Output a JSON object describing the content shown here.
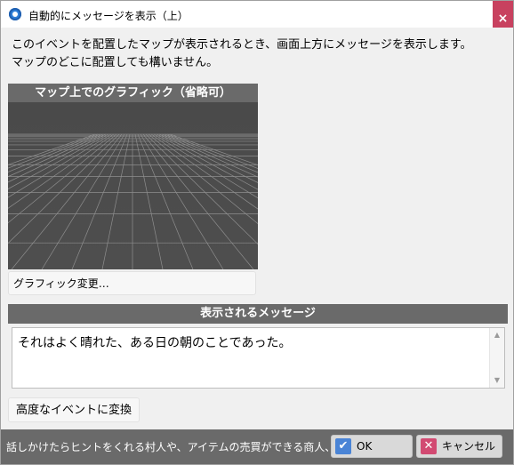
{
  "window": {
    "title": "自動的にメッセージを表示（上）",
    "close_glyph": "×",
    "icon": "app-gear-icon",
    "accent_close": "#c8415f"
  },
  "description": {
    "line1": "このイベントを配置したマップが表示されるとき、画面上方にメッセージを表示します。",
    "line2": "マップのどこに配置しても構いません。"
  },
  "graphic": {
    "header": "マップ上でのグラフィック（省略可）",
    "change_button": "グラフィック変更…"
  },
  "message": {
    "header": "表示されるメッセージ",
    "text": "それはよく晴れた、ある日の朝のことであった。",
    "scroll_up": "▲",
    "scroll_down": "▼"
  },
  "advanced_button": "高度なイベントに変換",
  "bottom": {
    "hint": "話しかけたらヒントをくれる村人や、アイテムの売買ができる商人、お金",
    "ok_label": "OK",
    "ok_icon": "✔",
    "cancel_label": "キャンセル",
    "cancel_icon": "✕"
  },
  "colors": {
    "header_bg": "#6a6a6a",
    "panel_bg": "#4e4e4e",
    "ok_icon_bg": "#4a84d6",
    "cancel_icon_bg": "#d24a72"
  }
}
